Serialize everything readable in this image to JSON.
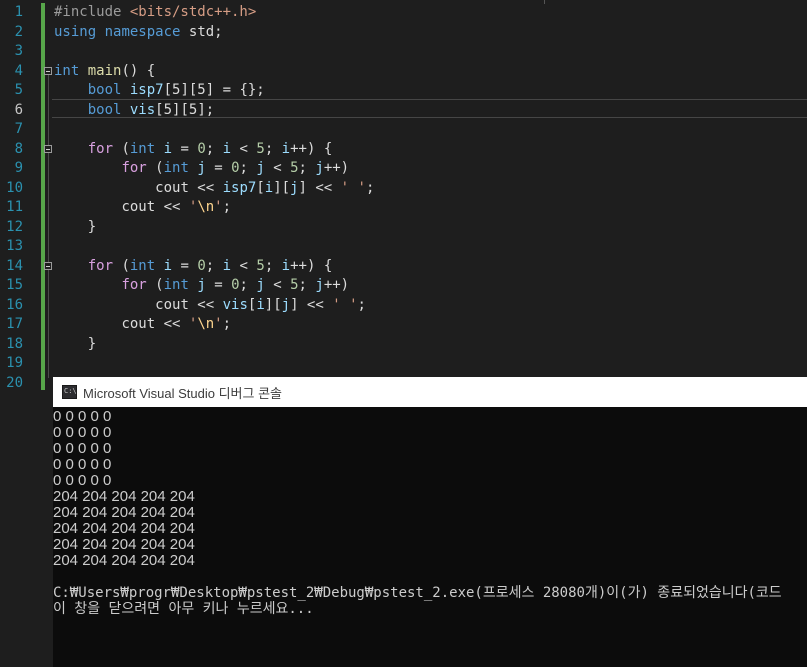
{
  "editor": {
    "line_numbers": [
      "1",
      "2",
      "3",
      "4",
      "5",
      "6",
      "7",
      "8",
      "9",
      "10",
      "11",
      "12",
      "13",
      "14",
      "15",
      "16",
      "17",
      "18",
      "19",
      "20"
    ],
    "active_line": "6",
    "lines": {
      "l1": {
        "directive": "#include ",
        "header": "<bits/stdc++.h>"
      },
      "l2": {
        "kw_using": "using",
        "kw_namespace": "namespace",
        "ns": "std;"
      },
      "l4": {
        "kw_int": "int",
        "fn": "main",
        "rest": "() {"
      },
      "l5": {
        "kw_bool": "bool",
        "var": "isp7",
        "rest": "[5][5] = {};"
      },
      "l6": {
        "kw_bool": "bool",
        "var": "vis",
        "rest": "[5][5];"
      },
      "l8": {
        "kw_for": "for",
        "p1": " (",
        "kw_int": "int",
        "p2": " ",
        "v_i1": "i",
        "p3": " = ",
        "n0": "0",
        "p4": "; ",
        "v_i2": "i",
        "p5": " < ",
        "n5": "5",
        "p6": "; ",
        "v_i3": "i",
        "p7": "++) {"
      },
      "l9": {
        "kw_for": "for",
        "p1": " (",
        "kw_int": "int",
        "p2": " ",
        "v_j1": "j",
        "p3": " = ",
        "n0": "0",
        "p4": "; ",
        "v_j2": "j",
        "p5": " < ",
        "n5": "5",
        "p6": "; ",
        "v_j3": "j",
        "p7": "++)"
      },
      "l10": {
        "cout": "cout",
        "op": " << ",
        "arr": "isp7",
        "idx1": "[",
        "i": "i",
        "idx2": "][",
        "j": "j",
        "idx3": "] << ",
        "chr": "' '",
        "end": ";"
      },
      "l11": {
        "cout": "cout",
        "op": " << ",
        "q1": "'",
        "esc": "\\n",
        "q2": "'",
        "end": ";"
      },
      "l12": {
        "brace": "}"
      },
      "l14": {
        "kw_for": "for",
        "p1": " (",
        "kw_int": "int",
        "p2": " ",
        "v_i1": "i",
        "p3": " = ",
        "n0": "0",
        "p4": "; ",
        "v_i2": "i",
        "p5": " < ",
        "n5": "5",
        "p6": "; ",
        "v_i3": "i",
        "p7": "++) {"
      },
      "l15": {
        "kw_for": "for",
        "p1": " (",
        "kw_int": "int",
        "p2": " ",
        "v_j1": "j",
        "p3": " = ",
        "n0": "0",
        "p4": "; ",
        "v_j2": "j",
        "p5": " < ",
        "n5": "5",
        "p6": "; ",
        "v_j3": "j",
        "p7": "++)"
      },
      "l16": {
        "cout": "cout",
        "op": " << ",
        "arr": "vis",
        "idx1": "[",
        "i": "i",
        "idx2": "][",
        "j": "j",
        "idx3": "] << ",
        "chr": "' '",
        "end": ";"
      },
      "l17": {
        "cout": "cout",
        "op": " << ",
        "q1": "'",
        "esc": "\\n",
        "q2": "'",
        "end": ";"
      },
      "l18": {
        "brace": "}"
      }
    }
  },
  "console": {
    "title": "Microsoft Visual Studio 디버그 콘솔",
    "icon_label": "C:\\",
    "output": [
      "0 0 0 0 0",
      "0 0 0 0 0",
      "0 0 0 0 0",
      "0 0 0 0 0",
      "0 0 0 0 0",
      "204 204 204 204 204",
      "204 204 204 204 204",
      "204 204 204 204 204",
      "204 204 204 204 204",
      "204 204 204 204 204",
      "",
      "C:₩Users₩progr₩Desktop₩pstest_2₩Debug₩pstest_2.exe(프로세스 28080개)이(가) 종료되었습니다(코드",
      "이 창을 닫으려면 아무 키나 누르세요..."
    ]
  },
  "colors": {
    "background": "#1e1e1e",
    "line_number": "#2b91af",
    "keyword": "#569cd6",
    "control_keyword": "#d8a0df",
    "string": "#d69d85",
    "number": "#b5cea8",
    "variable": "#9cdcfe",
    "function": "#dcdcaa",
    "change_bar": "#57a64a",
    "console_bg": "#0c0c0c"
  }
}
